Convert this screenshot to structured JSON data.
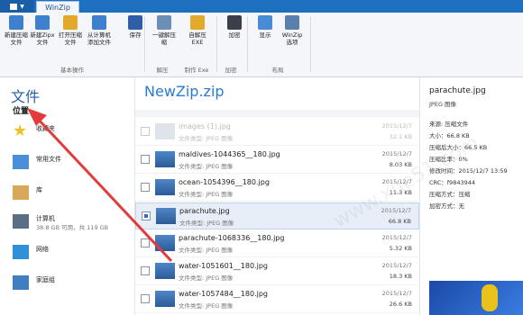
{
  "tabs": {
    "app_tab": "WinZip"
  },
  "ribbon": {
    "buttons": [
      {
        "name": "new-zip-button",
        "label": "新建压缩文件",
        "color": "#3f7fd0"
      },
      {
        "name": "new-zipx-button",
        "label": "新建Zipx文件",
        "color": "#3f7fd0"
      },
      {
        "name": "open-zip-button",
        "label": "打开压缩文件",
        "color": "#e2a92b"
      },
      {
        "name": "add-from-computer-button",
        "label": "从计算机添加文件",
        "color": "#3f7fd0"
      },
      {
        "name": "save-button",
        "label": "保存",
        "color": "#2f5fa8"
      },
      {
        "name": "one-click-unzip-button",
        "label": "一键解压缩",
        "color": "#6c8fb8"
      },
      {
        "name": "self-extract-exe-button",
        "label": "自解压EXE",
        "color": "#e2a92b"
      },
      {
        "name": "encrypt-button",
        "label": "加密",
        "color": "#3a3f4a"
      },
      {
        "name": "display-button",
        "label": "显示",
        "color": "#4a8bd6"
      },
      {
        "name": "winzip-options-button",
        "label": "WinZip选项",
        "color": "#5a7fae"
      }
    ],
    "groups": [
      "基本操作",
      "解压",
      "制作 Exe",
      "加密",
      "布局"
    ]
  },
  "left": {
    "title": "文件",
    "subtitle": "位置",
    "items": [
      {
        "label": "收藏夹",
        "sub": "",
        "icon": "star-icon"
      },
      {
        "label": "常用文件",
        "sub": "",
        "icon": "folder-icon"
      },
      {
        "label": "库",
        "sub": "",
        "icon": "library-icon"
      },
      {
        "label": "计算机",
        "sub": "38.8 GB 可用，共 119 GB",
        "icon": "computer-icon"
      },
      {
        "label": "网络",
        "sub": "",
        "icon": "network-icon"
      },
      {
        "label": "家庭组",
        "sub": "",
        "icon": "homegroup-icon"
      }
    ]
  },
  "middle": {
    "zip_name": "NewZip.zip",
    "files": [
      {
        "name": "images (1).jpg",
        "type": "文件类型: JPEG 图像",
        "date": "2015/12/7",
        "size": "32.1 KB",
        "faded": true,
        "selected": false
      },
      {
        "name": "maldives-1044365__180.jpg",
        "type": "文件类型: JPEG 图像",
        "date": "2015/12/7",
        "size": "8.03 KB",
        "faded": false,
        "selected": false
      },
      {
        "name": "ocean-1054396__180.jpg",
        "type": "文件类型: JPEG 图像",
        "date": "2015/12/7",
        "size": "11.3 KB",
        "faded": false,
        "selected": false
      },
      {
        "name": "parachute.jpg",
        "type": "文件类型: JPEG 图像",
        "date": "2015/12/7",
        "size": "66.8 KB",
        "faded": false,
        "selected": true
      },
      {
        "name": "parachute-1068336__180.jpg",
        "type": "文件类型: JPEG 图像",
        "date": "2015/12/7",
        "size": "5.32 KB",
        "faded": false,
        "selected": false
      },
      {
        "name": "water-1051601__180.jpg",
        "type": "文件类型: JPEG 图像",
        "date": "2015/12/7",
        "size": "18.3 KB",
        "faded": false,
        "selected": false
      },
      {
        "name": "water-1057484__180.jpg",
        "type": "文件类型: JPEG 图像",
        "date": "2015/12/7",
        "size": "26.6 KB",
        "faded": false,
        "selected": false
      }
    ]
  },
  "right": {
    "name": "parachute.jpg",
    "type": "JPEG 图像",
    "details": [
      "来源: 压缩文件",
      "大小：66.8 KB",
      "压缩后大小：66.5 KB",
      "压缩比率：0%",
      "修改时间：2015/12/7  13:59",
      "CRC：f9843944",
      "压缩方式：压缩",
      "加密方式：无"
    ]
  },
  "watermark": "www.xue51.com"
}
